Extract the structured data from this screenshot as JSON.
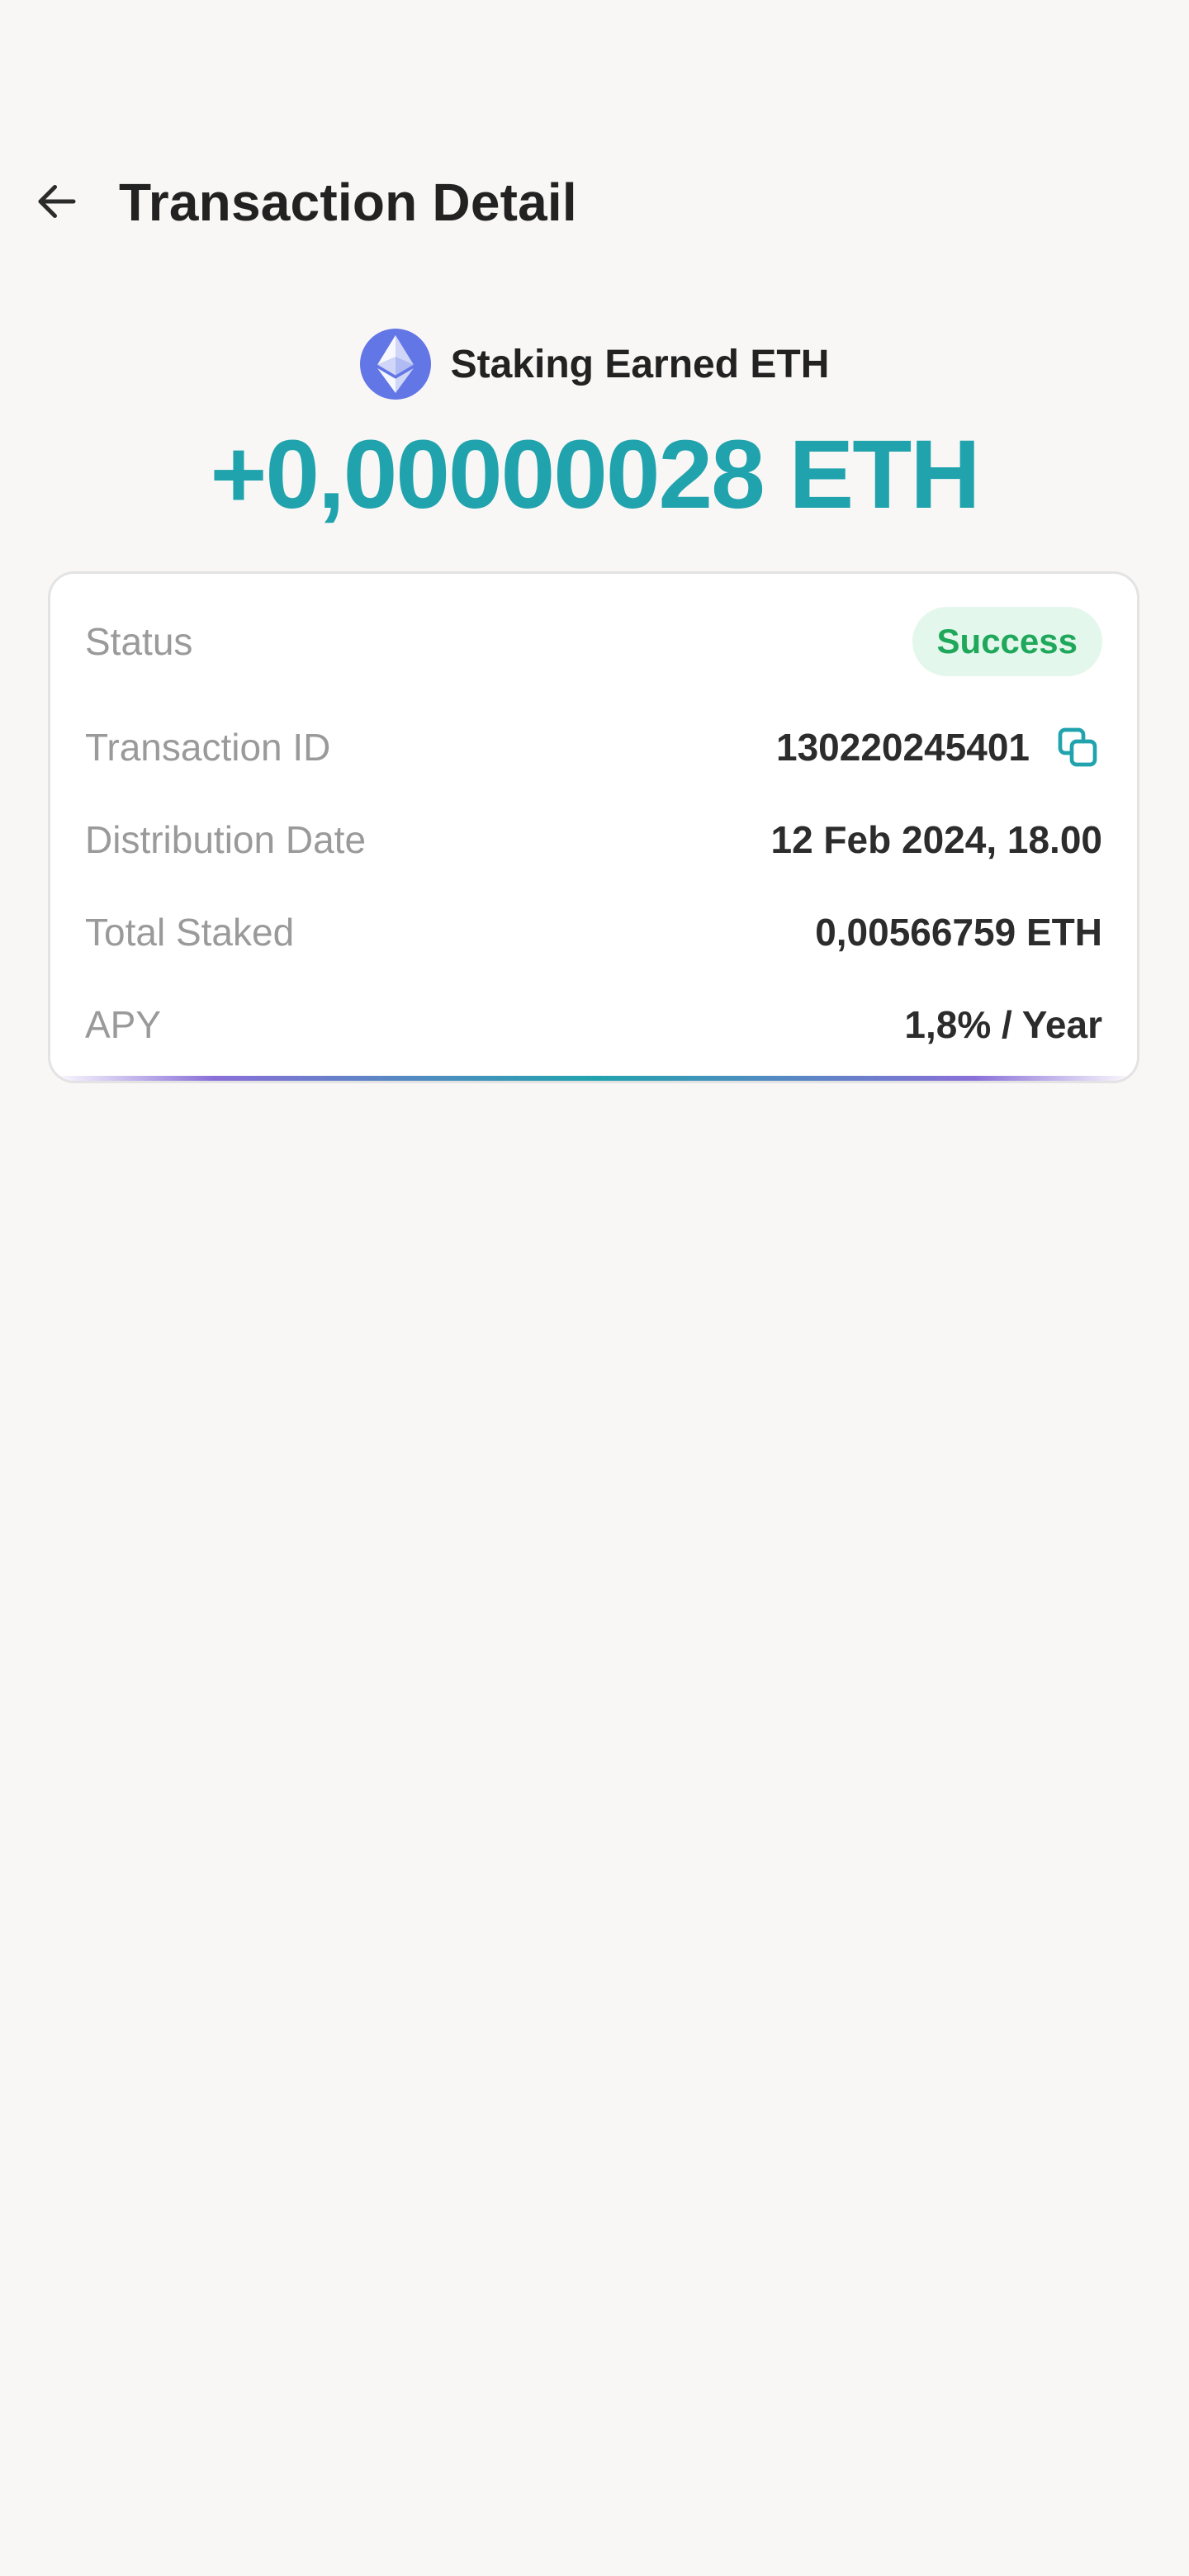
{
  "header": {
    "title": "Transaction Detail"
  },
  "asset": {
    "label": "Staking Earned ETH",
    "icon": "ethereum-logo-icon",
    "icon_color": "#6276e6"
  },
  "amount": "+0,00000028 ETH",
  "details": {
    "status": {
      "label": "Status",
      "value": "Success"
    },
    "transaction_id": {
      "label": "Transaction ID",
      "value": "130220245401"
    },
    "distribution_date": {
      "label": "Distribution Date",
      "value": "12 Feb 2024, 18.00"
    },
    "total_staked": {
      "label": "Total Staked",
      "value": "0,00566759 ETH"
    },
    "apy": {
      "label": "APY",
      "value": "1,8% / Year"
    }
  },
  "colors": {
    "accent": "#21a3ad",
    "success_text": "#1fa85b",
    "success_bg": "#e4f7ec",
    "background": "#f8f7f6"
  }
}
